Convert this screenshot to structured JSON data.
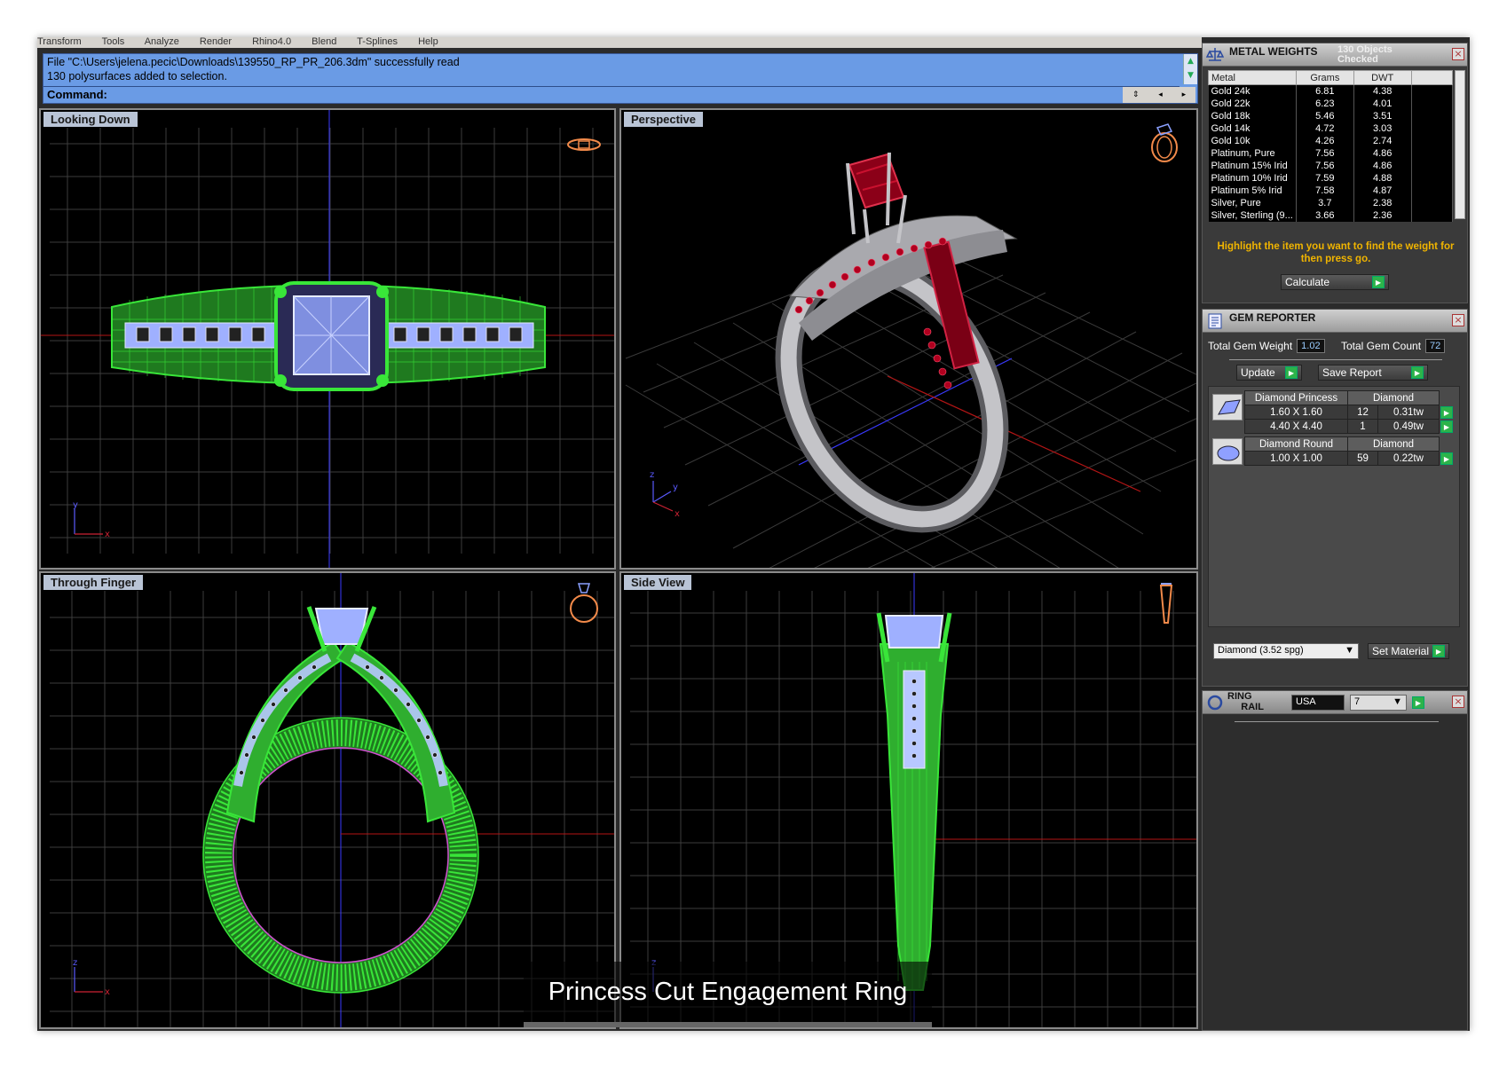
{
  "menu": [
    "Transform",
    "Tools",
    "Analyze",
    "Render",
    "Rhino4.0",
    "Blend",
    "T-Splines",
    "Help"
  ],
  "command": {
    "line1": "File \"C:\\Users\\jelena.pecic\\Downloads\\139550_RP_PR_206.3dm\" successfully read",
    "line2": "130 polysurfaces added to selection.",
    "prompt": "Command:"
  },
  "viewports": {
    "top_left": "Looking Down",
    "top_right": "Perspective",
    "bottom_left": "Through Finger",
    "bottom_right": "Side View"
  },
  "caption": "Princess Cut Engagement Ring",
  "metal_weights": {
    "title": "METAL WEIGHTS",
    "status": "130 Objects Checked",
    "columns": [
      "Metal",
      "Grams",
      "DWT"
    ],
    "rows": [
      [
        "Gold 24k",
        "6.81",
        "4.38"
      ],
      [
        "Gold 22k",
        "6.23",
        "4.01"
      ],
      [
        "Gold 18k",
        "5.46",
        "3.51"
      ],
      [
        "Gold 14k",
        "4.72",
        "3.03"
      ],
      [
        "Gold 10k",
        "4.26",
        "2.74"
      ],
      [
        "Platinum, Pure",
        "7.56",
        "4.86"
      ],
      [
        "Platinum 15% Irid",
        "7.56",
        "4.86"
      ],
      [
        "Platinum 10% Irid",
        "7.59",
        "4.88"
      ],
      [
        "Platinum 5% Irid",
        "7.58",
        "4.87"
      ],
      [
        "Silver, Pure",
        "3.7",
        "2.38"
      ],
      [
        "Silver, Sterling (9...",
        "3.66",
        "2.36"
      ]
    ],
    "hint": "Highlight the item you want to find the weight for then press go.",
    "calculate": "Calculate"
  },
  "gem_reporter": {
    "title": "GEM REPORTER",
    "total_weight_label": "Total Gem Weight",
    "total_weight": "1.02",
    "total_count_label": "Total Gem Count",
    "total_count": "72",
    "update": "Update",
    "save_report": "Save Report",
    "groups": [
      {
        "shape": "Diamond Princess",
        "material": "Diamond",
        "rows": [
          [
            "1.60 X 1.60",
            "12",
            "0.31tw"
          ],
          [
            "4.40 X 4.40",
            "1",
            "0.49tw"
          ]
        ]
      },
      {
        "shape": "Diamond Round",
        "material": "Diamond",
        "rows": [
          [
            "1.00 X 1.00",
            "59",
            "0.22tw"
          ]
        ]
      }
    ],
    "material_select": "Diamond     (3.52 spg)",
    "set_material": "Set Material"
  },
  "ring_rail": {
    "title_line1": "RING",
    "title_line2": "RAIL",
    "country": "USA",
    "size": "7"
  },
  "colors": {
    "command_bg": "#6a9be5",
    "wire": "#39e639",
    "gem_wire": "#b8c8ff",
    "ruby": "#a3001d",
    "metal": "#b8b8bc",
    "hint": "#f0b400",
    "go": "#2db34a"
  }
}
